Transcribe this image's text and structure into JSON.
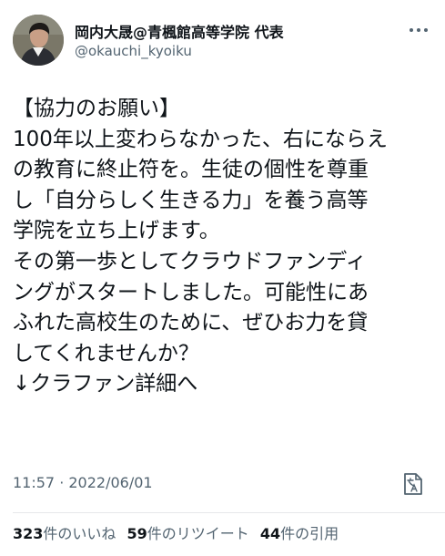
{
  "tweet": {
    "author_name": "岡内大晟@青楓館高等学院 代表",
    "author_handle": "@okauchi_kyoiku",
    "body_lines": [
      "【協力のお願い】",
      "100年以上変わらなかった、右にならえ",
      "の教育に終止符を。生徒の個性を尊重",
      "し「自分らしく生きる力」を養う高等",
      "学院を立ち上げます。",
      "その第一歩としてクラウドファンディ",
      "ングがスタートしました。可能性にあ",
      "ふれた高校生のために、ぜひお力を貸",
      "してくれませんか？",
      "↓クラファン詳細へ"
    ],
    "timestamp": "11:57 · 2022/06/01",
    "stats": {
      "likes": {
        "count": "323",
        "label": "件のいいね"
      },
      "retweets": {
        "count": "59",
        "label": "件のリツイート"
      },
      "quotes": {
        "count": "44",
        "label": "件の引用"
      }
    }
  },
  "icons": {
    "avatar": "avatar-photo",
    "more": "more-options-icon",
    "translate": "translate-icon"
  },
  "colors": {
    "text_primary": "#0f1419",
    "text_secondary": "#536471",
    "divider": "#e6e8ea"
  }
}
